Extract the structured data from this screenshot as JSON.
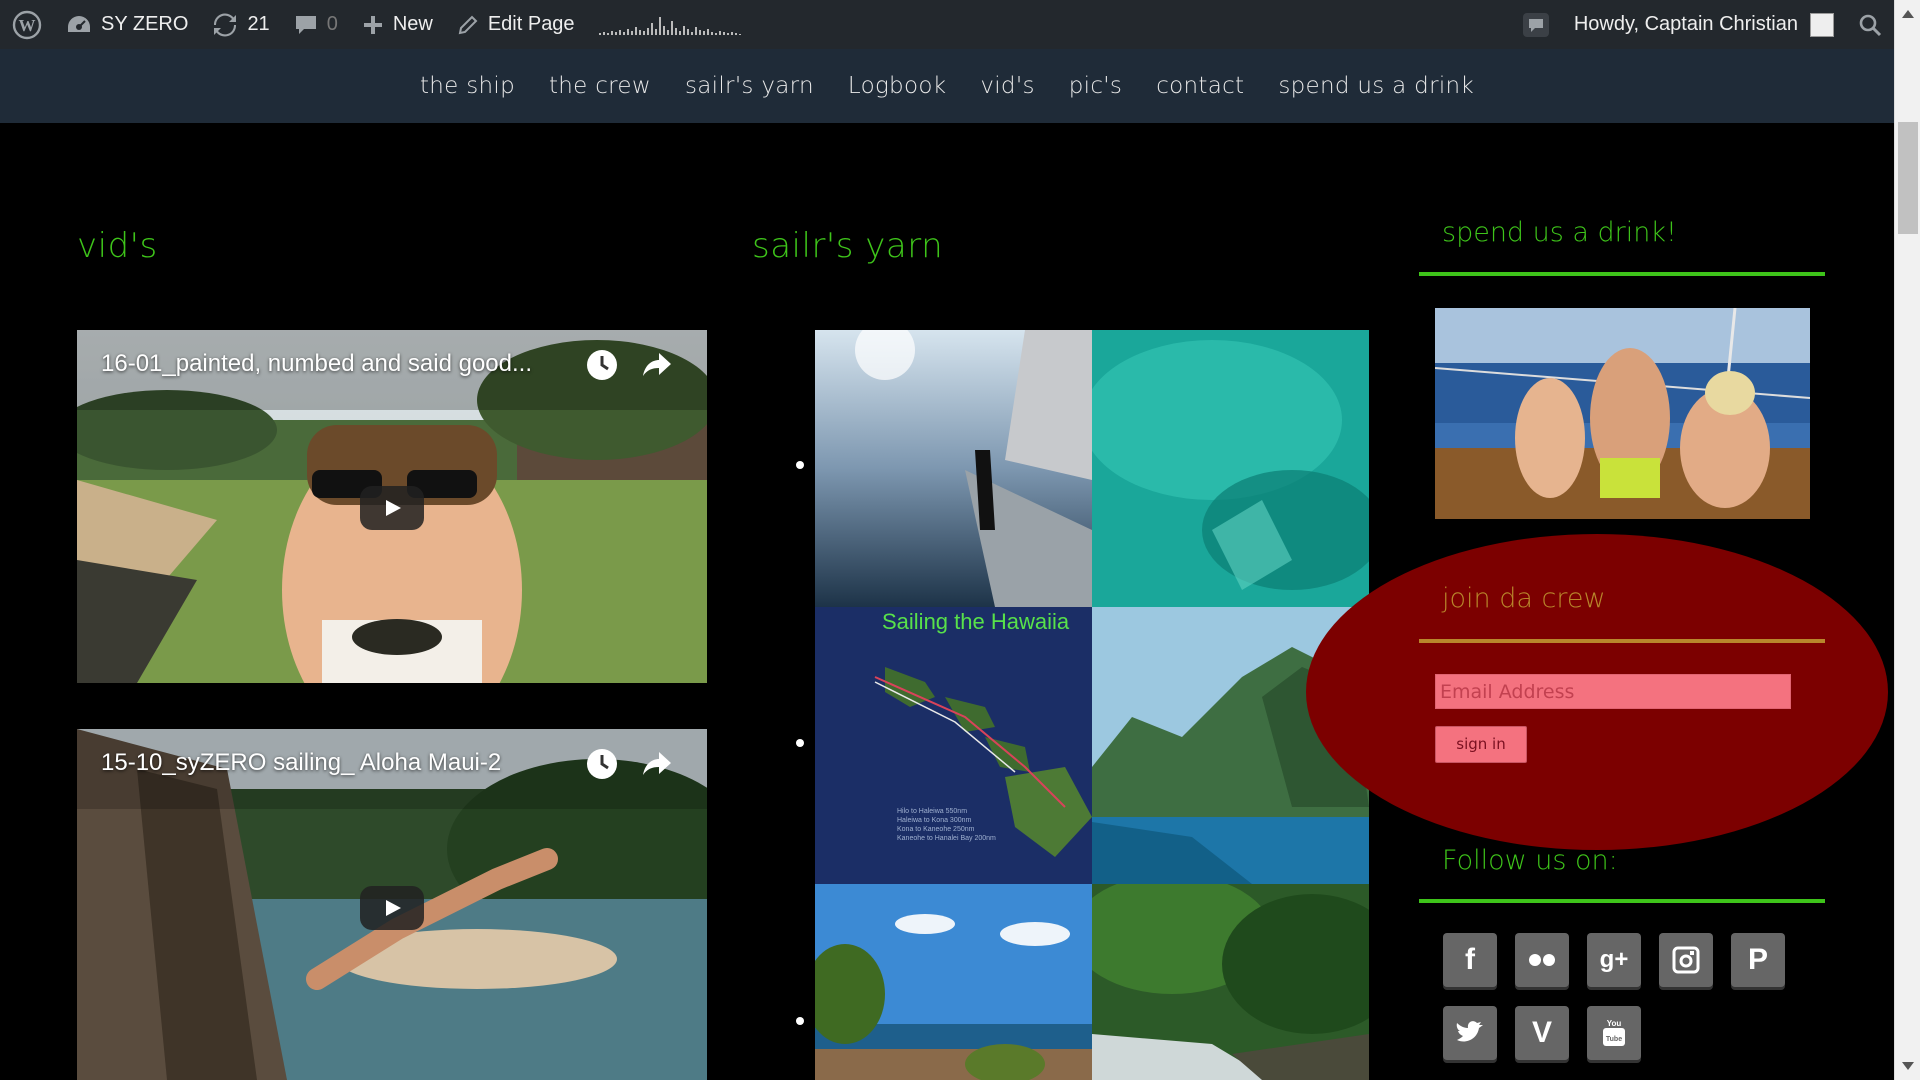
{
  "adminbar": {
    "site_name": "SY ZERO",
    "updates_count": "21",
    "comments_count": "0",
    "new_label": "New",
    "edit_label": "Edit Page",
    "howdy": "Howdy, Captain Christian"
  },
  "nav": {
    "items": [
      "the ship",
      "the crew",
      "sailr's yarn",
      "Logbook",
      "vid's",
      "pic's",
      "contact",
      "spend us a drink"
    ]
  },
  "videos": {
    "heading": "vid's",
    "items": [
      {
        "title": "16-01_painted, numbed and said good..."
      },
      {
        "title": "15-10_syZERO sailing_ Aloha Maui-2"
      }
    ]
  },
  "yarn": {
    "heading": "sailr's yarn",
    "map_caption": "Sailing the Hawaiia",
    "map_legend": [
      "Hilo to Haleiwa 550nm",
      "Haleiwa to Kona 300nm",
      "Kona to Kaneohe 250nm",
      "Kaneohe to Hanalei Bay 200nm"
    ]
  },
  "sidebar": {
    "drink_title": "spend us a drink!",
    "crew_title": "join da crew",
    "email_placeholder": "Email Address",
    "signin_label": "sign in",
    "follow_title": "Follow us on:",
    "social_icons": [
      "facebook-icon",
      "flickr-icon",
      "google-plus-icon",
      "instagram-icon",
      "pinterest-icon",
      "twitter-icon",
      "vimeo-icon",
      "youtube-icon"
    ]
  },
  "colors": {
    "accent_green": "#3ec41a",
    "crew_red": "#7c0000",
    "crew_gold": "#b8862b",
    "admin_bg": "#23282d",
    "nav_bg": "#1f2b38"
  }
}
